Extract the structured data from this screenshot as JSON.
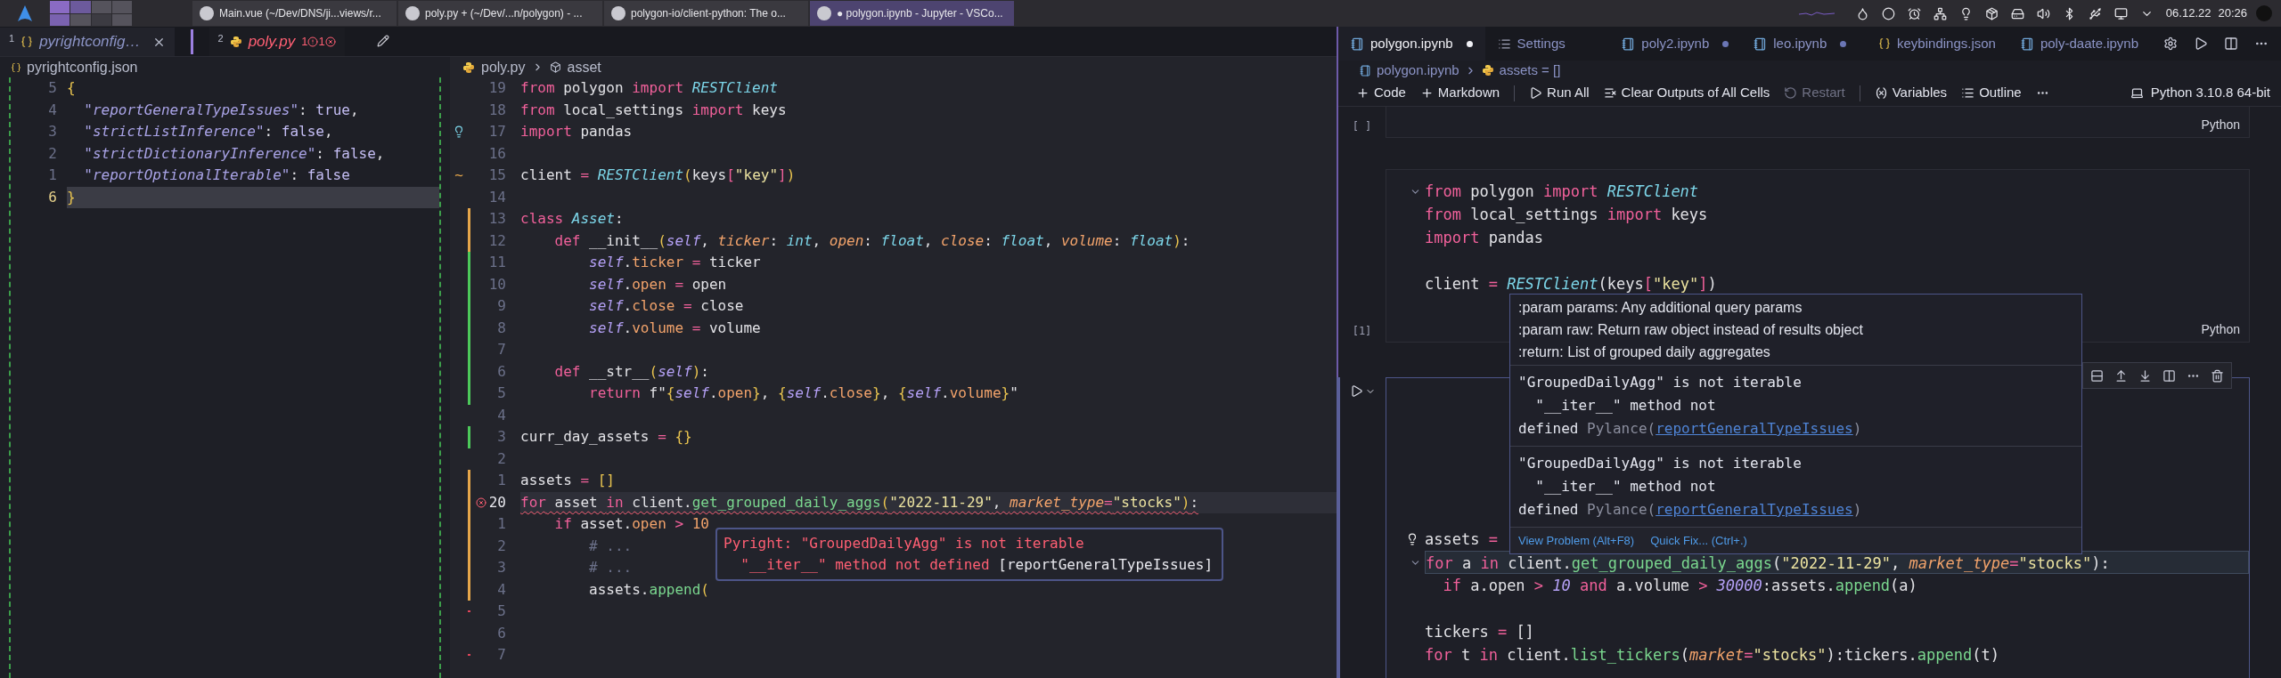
{
  "taskbar": {
    "tasks": [
      {
        "label": "Main.vue (~/Dev/DNS/ji...views/r...",
        "selected": false
      },
      {
        "label": "poly.py + (~/Dev/...n/polygon) - ...",
        "selected": false
      },
      {
        "label": "polygon-io/client-python: The o...",
        "selected": false
      },
      {
        "label": "● polygon.ipynb - Jupyter - VSCo...",
        "selected": true
      }
    ],
    "date": "06.12.22",
    "time": "20:26"
  },
  "editor_tabs": [
    {
      "index": "1",
      "label": "pyrightconfig…",
      "kind": "json",
      "selected": false
    },
    {
      "index": "2",
      "label": "poly.py",
      "kind": "python",
      "selected": true,
      "warnings": "1",
      "errors": "1"
    }
  ],
  "left_editor": {
    "breadcrumb": "pyrightconfig.json",
    "lines": [
      {
        "number": "5",
        "current": false,
        "tokens": [
          {
            "kind": "br",
            "text": "{"
          }
        ]
      },
      {
        "number": "4",
        "current": false,
        "tokens": [
          {
            "kind": "key",
            "text": "  \"reportGeneralTypeIssues\""
          },
          {
            "kind": "pl",
            "text": ": "
          },
          {
            "kind": "bool",
            "text": "true"
          },
          {
            "kind": "pl",
            "text": ","
          }
        ]
      },
      {
        "number": "3",
        "current": false,
        "tokens": [
          {
            "kind": "key",
            "text": "  \"strictListInference\""
          },
          {
            "kind": "pl",
            "text": ": "
          },
          {
            "kind": "bool",
            "text": "false"
          },
          {
            "kind": "pl",
            "text": ","
          }
        ]
      },
      {
        "number": "2",
        "current": false,
        "tokens": [
          {
            "kind": "key",
            "text": "  \"strictDictionaryInference\""
          },
          {
            "kind": "pl",
            "text": ": "
          },
          {
            "kind": "bool",
            "text": "false"
          },
          {
            "kind": "pl",
            "text": ","
          }
        ]
      },
      {
        "number": "1",
        "current": false,
        "tokens": [
          {
            "kind": "key",
            "text": "  \"reportOptionalIterable\""
          },
          {
            "kind": "pl",
            "text": ": "
          },
          {
            "kind": "bool",
            "text": "false"
          }
        ]
      },
      {
        "number": "6",
        "current": true,
        "tokens": [
          {
            "kind": "br",
            "text": "}"
          }
        ]
      }
    ]
  },
  "middle_editor": {
    "breadcrumb": [
      "poly.py",
      "asset"
    ],
    "lines": [
      {
        "number": "19",
        "current": false,
        "tokens": [
          {
            "kind": "kw",
            "text": "from"
          },
          {
            "kind": "pl",
            "text": " polygon "
          },
          {
            "kind": "kw",
            "text": "import"
          },
          {
            "kind": "cls",
            "text": " RESTClient"
          }
        ]
      },
      {
        "number": "18",
        "current": false,
        "tokens": [
          {
            "kind": "kw",
            "text": "from"
          },
          {
            "kind": "pl",
            "text": " local_settings "
          },
          {
            "kind": "kw",
            "text": "import"
          },
          {
            "kind": "pl",
            "text": " keys"
          }
        ]
      },
      {
        "number": "17",
        "current": false,
        "lightbulb": true,
        "tokens": [
          {
            "kind": "kw",
            "text": "import"
          },
          {
            "kind": "pl",
            "text": " pandas"
          }
        ]
      },
      {
        "number": "16",
        "current": false
      },
      {
        "number": "15",
        "current": false,
        "gutter": "~",
        "tokens": [
          {
            "kind": "pl",
            "text": "client "
          },
          {
            "kind": "op",
            "text": "="
          },
          {
            "kind": "cls",
            "text": " RESTClient"
          },
          {
            "kind": "br",
            "text": "("
          },
          {
            "kind": "pl",
            "text": "keys"
          },
          {
            "kind": "op",
            "text": "["
          },
          {
            "kind": "str",
            "text": "\"key\""
          },
          {
            "kind": "op",
            "text": "]"
          },
          {
            "kind": "br",
            "text": ")"
          }
        ]
      },
      {
        "number": "14",
        "current": false
      },
      {
        "number": "13",
        "current": false,
        "color": "#e5a64a",
        "tokens": [
          {
            "kind": "kw",
            "text": "class"
          },
          {
            "kind": "cls",
            "text": " Asset"
          },
          {
            "kind": "pl",
            "text": ":"
          }
        ]
      },
      {
        "number": "12",
        "current": false,
        "color": "#e5a64a",
        "tokens": [
          {
            "kind": "kw",
            "text": "    def"
          },
          {
            "kind": "pl",
            "text": " __init__"
          },
          {
            "kind": "br",
            "text": "("
          },
          {
            "kind": "self",
            "text": "self"
          },
          {
            "kind": "pl",
            "text": ", "
          },
          {
            "kind": "param",
            "text": "ticker"
          },
          {
            "kind": "pl",
            "text": ": "
          },
          {
            "kind": "cls",
            "text": "int"
          },
          {
            "kind": "pl",
            "text": ", "
          },
          {
            "kind": "param",
            "text": "open"
          },
          {
            "kind": "pl",
            "text": ": "
          },
          {
            "kind": "cls",
            "text": "float"
          },
          {
            "kind": "pl",
            "text": ", "
          },
          {
            "kind": "param",
            "text": "close"
          },
          {
            "kind": "pl",
            "text": ": "
          },
          {
            "kind": "cls",
            "text": "float"
          },
          {
            "kind": "pl",
            "text": ", "
          },
          {
            "kind": "param",
            "text": "volume"
          },
          {
            "kind": "pl",
            "text": ": "
          },
          {
            "kind": "cls",
            "text": "float"
          },
          {
            "kind": "br",
            "text": ")"
          },
          {
            "kind": "pl",
            "text": ":"
          }
        ]
      },
      {
        "number": "11",
        "current": false,
        "color": "#4cc95a",
        "tokens": [
          {
            "kind": "self",
            "text": "        self"
          },
          {
            "kind": "pl",
            "text": "."
          },
          {
            "kind": "attr",
            "text": "ticker"
          },
          {
            "kind": "op",
            "text": " = "
          },
          {
            "kind": "pl",
            "text": "ticker"
          }
        ]
      },
      {
        "number": "10",
        "current": false,
        "color": "#4cc95a",
        "tokens": [
          {
            "kind": "self",
            "text": "        self"
          },
          {
            "kind": "pl",
            "text": "."
          },
          {
            "kind": "attr",
            "text": "open"
          },
          {
            "kind": "op",
            "text": " = "
          },
          {
            "kind": "pl",
            "text": "open"
          }
        ]
      },
      {
        "number": "9",
        "current": false,
        "color": "#4cc95a",
        "tokens": [
          {
            "kind": "self",
            "text": "        self"
          },
          {
            "kind": "pl",
            "text": "."
          },
          {
            "kind": "attr",
            "text": "close"
          },
          {
            "kind": "op",
            "text": " = "
          },
          {
            "kind": "pl",
            "text": "close"
          }
        ]
      },
      {
        "number": "8",
        "current": false,
        "color": "#4cc95a",
        "tokens": [
          {
            "kind": "self",
            "text": "        self"
          },
          {
            "kind": "pl",
            "text": "."
          },
          {
            "kind": "attr",
            "text": "volume"
          },
          {
            "kind": "op",
            "text": " = "
          },
          {
            "kind": "pl",
            "text": "volume"
          }
        ]
      },
      {
        "number": "7",
        "current": false,
        "color": "#4cc95a"
      },
      {
        "number": "6",
        "current": false,
        "color": "#4cc95a",
        "tokens": [
          {
            "kind": "kw",
            "text": "    def"
          },
          {
            "kind": "pl",
            "text": " __str__"
          },
          {
            "kind": "br",
            "text": "("
          },
          {
            "kind": "self",
            "text": "self"
          },
          {
            "kind": "br",
            "text": ")"
          },
          {
            "kind": "pl",
            "text": ":"
          }
        ]
      },
      {
        "number": "5",
        "current": false,
        "color": "#4cc95a",
        "tokens": [
          {
            "kind": "kw",
            "text": "        return"
          },
          {
            "kind": "pl",
            "text": " f\""
          },
          {
            "kind": "br",
            "text": "{"
          },
          {
            "kind": "self",
            "text": "self"
          },
          {
            "kind": "pl",
            "text": "."
          },
          {
            "kind": "attr",
            "text": "open"
          },
          {
            "kind": "br",
            "text": "}"
          },
          {
            "kind": "pl",
            "text": ", "
          },
          {
            "kind": "br",
            "text": "{"
          },
          {
            "kind": "self",
            "text": "self"
          },
          {
            "kind": "pl",
            "text": "."
          },
          {
            "kind": "attr",
            "text": "close"
          },
          {
            "kind": "br",
            "text": "}"
          },
          {
            "kind": "pl",
            "text": ", "
          },
          {
            "kind": "br",
            "text": "{"
          },
          {
            "kind": "self",
            "text": "self"
          },
          {
            "kind": "pl",
            "text": "."
          },
          {
            "kind": "attr",
            "text": "volume"
          },
          {
            "kind": "br",
            "text": "}"
          },
          {
            "kind": "pl",
            "text": "\""
          }
        ]
      },
      {
        "number": "4",
        "current": false
      },
      {
        "number": "3",
        "current": false,
        "color": "#4cc95a",
        "tokens": [
          {
            "kind": "pl",
            "text": "curr_day_assets "
          },
          {
            "kind": "op",
            "text": "="
          },
          {
            "kind": "br",
            "text": " {}"
          }
        ]
      },
      {
        "number": "2",
        "current": false
      },
      {
        "number": "1",
        "current": false,
        "color": "#e5a64a",
        "tokens": [
          {
            "kind": "pl",
            "text": "assets "
          },
          {
            "kind": "op",
            "text": "="
          },
          {
            "kind": "br",
            "text": " []"
          }
        ]
      },
      {
        "number": "20",
        "current": true,
        "error": true,
        "color": "#e5a64a",
        "tokens": [
          {
            "kind": "kw",
            "text": "for"
          },
          {
            "kind": "pl",
            "text": " asset "
          },
          {
            "kind": "kw",
            "text": "in"
          },
          {
            "kind": "pl",
            "text": " client."
          },
          {
            "kind": "fn",
            "text": "get_grouped_daily_aggs"
          },
          {
            "kind": "br",
            "text": "("
          },
          {
            "kind": "str",
            "text": "\"2022-11-29\""
          },
          {
            "kind": "pl",
            "text": ", "
          },
          {
            "kind": "param",
            "text": "market_type"
          },
          {
            "kind": "op",
            "text": "="
          },
          {
            "kind": "str",
            "text": "\"stocks\""
          },
          {
            "kind": "br",
            "text": ")"
          },
          {
            "kind": "pl",
            "text": ":"
          }
        ]
      },
      {
        "number": "1",
        "current": false,
        "color": "#e5a64a",
        "tokens": [
          {
            "kind": "kw",
            "text": "    if"
          },
          {
            "kind": "pl",
            "text": " asset."
          },
          {
            "kind": "attr",
            "text": "open"
          },
          {
            "kind": "op",
            "text": " > "
          },
          {
            "kind": "attr",
            "text": "10"
          }
        ]
      },
      {
        "number": "2",
        "current": false,
        "color": "#e5a64a",
        "tokens": [
          {
            "kind": "com",
            "text": "        # ..."
          }
        ]
      },
      {
        "number": "3",
        "current": false,
        "color": "#e5a64a",
        "tokens": [
          {
            "kind": "com",
            "text": "        # ..."
          }
        ]
      },
      {
        "number": "4",
        "current": false,
        "color": "#e5a64a",
        "tokens": [
          {
            "kind": "pl",
            "text": "        assets."
          },
          {
            "kind": "fn",
            "text": "append"
          },
          {
            "kind": "br",
            "text": "("
          }
        ]
      },
      {
        "number": "5",
        "current": false,
        "color": "#e0455a"
      },
      {
        "number": "6",
        "current": false
      },
      {
        "number": "7",
        "current": false,
        "color": "#e0455a"
      }
    ],
    "hover": {
      "message": "Pyright: \"GroupedDailyAgg\" is not iterable\n  \"__iter__\" method not defined",
      "rule": "[reportGeneralTypeIssues]"
    }
  },
  "notebook": {
    "tabs": [
      {
        "label": "polygon.ipynb",
        "kind": "notebook",
        "selected": true,
        "modified": true
      },
      {
        "label": "Settings",
        "kind": "settings",
        "selected": false,
        "modified": false
      },
      {
        "label": "poly2.ipynb",
        "kind": "notebook",
        "selected": false,
        "modified": true
      },
      {
        "label": "leo.ipynb",
        "kind": "notebook",
        "selected": false,
        "modified": true
      },
      {
        "label": "keybindings.json",
        "kind": "json",
        "selected": false,
        "modified": false
      },
      {
        "label": "poly-daate.ipynb",
        "kind": "notebook",
        "selected": false,
        "modified": false
      }
    ],
    "breadcrumb": [
      "polygon.ipynb",
      "assets = []"
    ],
    "toolbar": [
      [
        {
          "kind": "add",
          "label": "Code",
          "disabled": false
        },
        {
          "kind": "add",
          "label": "Markdown",
          "disabled": false
        }
      ],
      [
        {
          "kind": "run",
          "label": "Run All",
          "disabled": false
        },
        {
          "kind": "clear",
          "label": "Clear Outputs of All Cells",
          "disabled": false
        },
        {
          "kind": "restart",
          "label": "Restart",
          "disabled": true
        }
      ],
      [
        {
          "kind": "variables",
          "label": "Variables",
          "disabled": false
        },
        {
          "kind": "outline",
          "label": "Outline",
          "disabled": false
        }
      ]
    ],
    "kernel": "Python 3.10.8 64-bit",
    "cells": [
      {
        "kind": "idle",
        "label": "[ ]",
        "language": "Python"
      },
      {
        "kind": "executed",
        "label": "[1]",
        "language": "Python",
        "lines": [
          {
            "current": false,
            "tokens": [
              {
                "kind": "kw",
                "text": "from"
              },
              {
                "kind": "pl",
                "text": " polygon "
              },
              {
                "kind": "kw",
                "text": "import"
              },
              {
                "kind": "cls",
                "text": " RESTClient"
              }
            ]
          },
          {
            "current": false,
            "tokens": [
              {
                "kind": "kw",
                "text": "from"
              },
              {
                "kind": "pl",
                "text": " local_settings "
              },
              {
                "kind": "kw",
                "text": "import"
              },
              {
                "kind": "pl",
                "text": " keys"
              }
            ]
          },
          {
            "current": false,
            "tokens": [
              {
                "kind": "kw",
                "text": "import"
              },
              {
                "kind": "pl",
                "text": " pandas"
              }
            ]
          },
          {
            "current": false
          },
          {
            "current": false,
            "tokens": [
              {
                "kind": "pl",
                "text": "client "
              },
              {
                "kind": "op",
                "text": "="
              },
              {
                "kind": "cls",
                "text": " RESTClient"
              },
              {
                "kind": "pl",
                "text": "(keys"
              },
              {
                "kind": "op",
                "text": "["
              },
              {
                "kind": "str",
                "text": "\"key\""
              },
              {
                "kind": "op",
                "text": "]"
              },
              {
                "kind": "pl",
                "text": ")"
              }
            ]
          }
        ]
      },
      {
        "kind": "focused",
        "lines": [
          {
            "current": false,
            "tokens": [
              {
                "kind": "pl",
                "text": "assets "
              },
              {
                "kind": "op",
                "text": "="
              }
            ]
          },
          {
            "current": true,
            "tokens": [
              {
                "kind": "kw",
                "text": "for"
              },
              {
                "kind": "pl",
                "text": " a "
              },
              {
                "kind": "kw",
                "text": "in"
              },
              {
                "kind": "pl",
                "text": " client."
              },
              {
                "kind": "fn",
                "text": "get_grouped_daily_aggs"
              },
              {
                "kind": "pl",
                "text": "("
              },
              {
                "kind": "str",
                "text": "\"2022-11-29\""
              },
              {
                "kind": "pl",
                "text": ", "
              },
              {
                "kind": "param",
                "text": "market_type"
              },
              {
                "kind": "op",
                "text": "="
              },
              {
                "kind": "str",
                "text": "\"stocks\""
              },
              {
                "kind": "pl",
                "text": "):"
              }
            ]
          },
          {
            "current": false,
            "tokens": [
              {
                "kind": "kw",
                "text": "  if"
              },
              {
                "kind": "pl",
                "text": " a.open "
              },
              {
                "kind": "op",
                "text": ">"
              },
              {
                "kind": "num",
                "text": " 10"
              },
              {
                "kind": "kw",
                "text": " and"
              },
              {
                "kind": "pl",
                "text": " a.volume "
              },
              {
                "kind": "op",
                "text": ">"
              },
              {
                "kind": "num",
                "text": " 30000"
              },
              {
                "kind": "pl",
                "text": ":assets."
              },
              {
                "kind": "fn",
                "text": "append"
              },
              {
                "kind": "pl",
                "text": "(a)"
              }
            ]
          },
          {
            "current": false
          },
          {
            "current": false,
            "tokens": [
              {
                "kind": "pl",
                "text": "tickers "
              },
              {
                "kind": "op",
                "text": "="
              },
              {
                "kind": "pl",
                "text": " []"
              }
            ]
          },
          {
            "current": false,
            "tokens": [
              {
                "kind": "kw",
                "text": "for"
              },
              {
                "kind": "pl",
                "text": " t "
              },
              {
                "kind": "kw",
                "text": "in"
              },
              {
                "kind": "pl",
                "text": " client."
              },
              {
                "kind": "fn",
                "text": "list_tickers"
              },
              {
                "kind": "pl",
                "text": "("
              },
              {
                "kind": "param",
                "text": "market"
              },
              {
                "kind": "op",
                "text": "="
              },
              {
                "kind": "str",
                "text": "\"stocks\""
              },
              {
                "kind": "pl",
                "text": "):tickers."
              },
              {
                "kind": "fn",
                "text": "append"
              },
              {
                "kind": "pl",
                "text": "(t)"
              }
            ]
          }
        ]
      }
    ],
    "hover": {
      "doc": [
        ":param params: Any additional query params",
        ":param raw: Return raw object instead of results object",
        ":return: List of grouped daily aggregates"
      ],
      "problems": [
        {
          "message": "\"GroupedDailyAgg\" is not iterable\n  \"__iter__\" method not\ndefined",
          "source": "Pylance(",
          "code": "reportGeneralTypeIssues",
          "close": ")"
        },
        {
          "message": "\"GroupedDailyAgg\" is not iterable\n  \"__iter__\" method not\ndefined",
          "source": "Pylance(",
          "code": "reportGeneralTypeIssues",
          "close": ")"
        }
      ],
      "actions": [
        "View Problem (Alt+F8)",
        "Quick Fix... (Ctrl+.)"
      ]
    }
  }
}
